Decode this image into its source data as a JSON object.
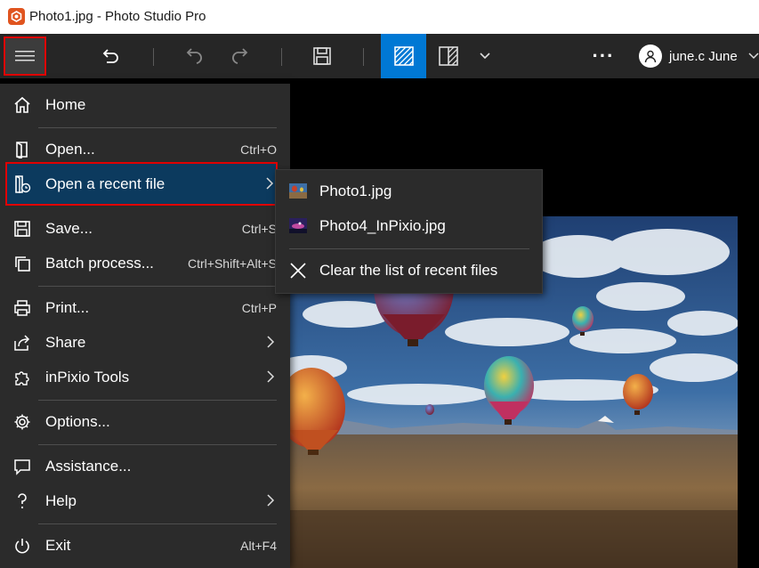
{
  "window": {
    "title": "Photo1.jpg - Photo Studio Pro"
  },
  "toolbar": {
    "icons": [
      "menu-icon",
      "undo-all-icon",
      "undo-icon",
      "redo-icon",
      "save-icon",
      "single-view-icon",
      "compare-view-icon",
      "chevron-down-icon",
      "more-icon"
    ],
    "more_label": "···",
    "user_name": "june.c June",
    "accent": "#0078d4"
  },
  "menu": {
    "items": [
      {
        "label": "Home",
        "shortcut": "",
        "icon": "home-icon"
      },
      {
        "label": "Open...",
        "shortcut": "Ctrl+O",
        "icon": "open-icon"
      },
      {
        "label": "Open a recent file",
        "shortcut": "",
        "icon": "recent-file-icon"
      },
      {
        "label": "Save...",
        "shortcut": "Ctrl+S",
        "icon": "save-icon"
      },
      {
        "label": "Batch process...",
        "shortcut": "Ctrl+Shift+Alt+S",
        "icon": "batch-icon"
      },
      {
        "label": "Print...",
        "shortcut": "Ctrl+P",
        "icon": "print-icon"
      },
      {
        "label": "Share",
        "shortcut": "",
        "icon": "share-icon"
      },
      {
        "label": "inPixio Tools",
        "shortcut": "",
        "icon": "puzzle-icon"
      },
      {
        "label": "Options...",
        "shortcut": "",
        "icon": "gear-icon"
      },
      {
        "label": "Assistance...",
        "shortcut": "",
        "icon": "chat-icon"
      },
      {
        "label": "Help",
        "shortcut": "",
        "icon": "question-icon"
      },
      {
        "label": "Exit",
        "shortcut": "Alt+F4",
        "icon": "power-icon"
      }
    ]
  },
  "recent": {
    "files": [
      "Photo1.jpg",
      "Photo4_InPixio.jpg"
    ],
    "clear_label": "Clear the list of recent files"
  }
}
